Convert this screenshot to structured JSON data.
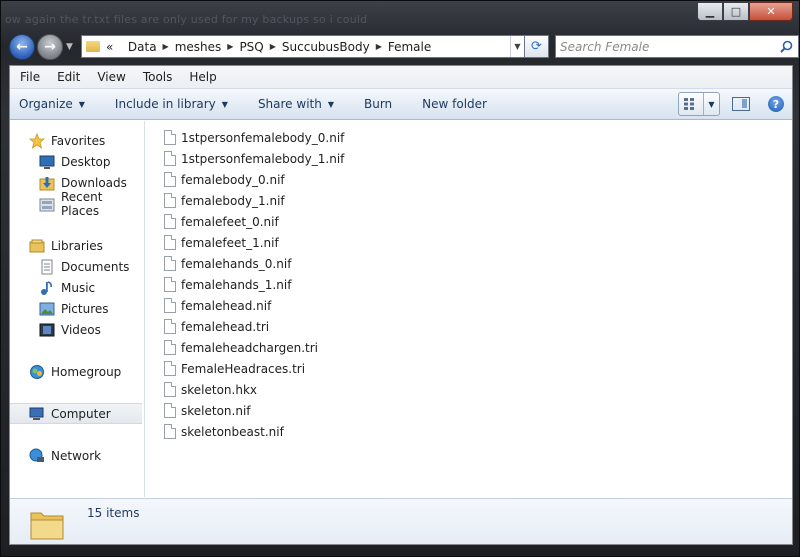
{
  "background_text": "ow again the tr.txt files are only used for my backups so i could",
  "window": {
    "minimize": "▁",
    "maximize": "□",
    "close": "✕"
  },
  "nav": {
    "back_icon": "back-arrow-icon",
    "forward_icon": "forward-arrow-icon",
    "breadcrumb_prefix": "«",
    "breadcrumbs": [
      "Data",
      "meshes",
      "PSQ",
      "SuccubusBody",
      "Female"
    ],
    "search_placeholder": "Search Female"
  },
  "menu": [
    "File",
    "Edit",
    "View",
    "Tools",
    "Help"
  ],
  "commands": {
    "organize": "Organize",
    "include_in_library": "Include in library",
    "share_with": "Share with",
    "burn": "Burn",
    "new_folder": "New folder"
  },
  "navpane": {
    "favorites": "Favorites",
    "desktop": "Desktop",
    "downloads": "Downloads",
    "recent_places": "Recent Places",
    "libraries": "Libraries",
    "documents": "Documents",
    "music": "Music",
    "pictures": "Pictures",
    "videos": "Videos",
    "homegroup": "Homegroup",
    "computer": "Computer",
    "network": "Network"
  },
  "files": [
    "1stpersonfemalebody_0.nif",
    "1stpersonfemalebody_1.nif",
    "femalebody_0.nif",
    "femalebody_1.nif",
    "femalefeet_0.nif",
    "femalefeet_1.nif",
    "femalehands_0.nif",
    "femalehands_1.nif",
    "femalehead.nif",
    "femalehead.tri",
    "femaleheadchargen.tri",
    "FemaleHeadraces.tri",
    "skeleton.hkx",
    "skeleton.nif",
    "skeletonbeast.nif"
  ],
  "details": {
    "item_count": "15 items"
  },
  "colors": {
    "accent": "#1e395b",
    "frame": "#2a2d33",
    "folder": "#e8c25a"
  }
}
